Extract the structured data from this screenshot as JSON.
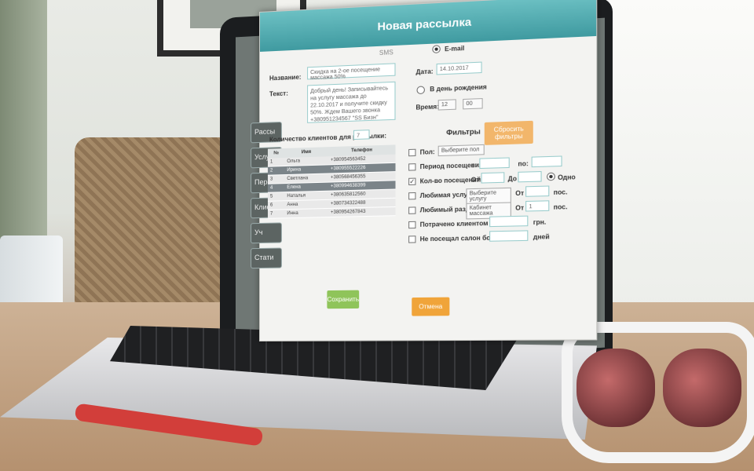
{
  "window": {
    "title": "Новая рассылка"
  },
  "sidebar": {
    "items": [
      "Рассы",
      "Услу",
      "Персо",
      "Клие",
      "Уч",
      "Стати"
    ]
  },
  "form": {
    "sms_label": "SMS",
    "email_label": "E-mail",
    "name_label": "Название:",
    "name_value": "Скидка на 2-ое посещение массажа 50%",
    "text_label": "Текст:",
    "text_value": "Добрый день! Записывайтесь на услугу массажа до 22.10.2017 и получите скидку 50%. Ждем Вашего звонка +380951234567 \"SS Бизн\"",
    "date_label": "Дата:",
    "date_value": "14.10.2017",
    "birthday_label": "В день рождения",
    "time_label": "Время:",
    "hour_value": "12",
    "minute_value": "00",
    "clients_count_label": "Количество клиентов для рассылки:",
    "clients_count_value": "7"
  },
  "table": {
    "headers": [
      "№",
      "Имя",
      "Телефон"
    ],
    "rows": [
      [
        "1",
        "Ольга",
        "+380954563452"
      ],
      [
        "2",
        "Ирина",
        "+380955522226"
      ],
      [
        "3",
        "Светлана",
        "+380568456355"
      ],
      [
        "4",
        "Елена",
        "+380994638399"
      ],
      [
        "5",
        "Наталья",
        "+380635812560"
      ],
      [
        "6",
        "Анна",
        "+380734322488"
      ],
      [
        "7",
        "Инна",
        "+380954267843"
      ]
    ]
  },
  "filters": {
    "title": "Фильтры",
    "reset_label": "Сбросить фильтры",
    "gender_label": "Пол:",
    "gender_value": "Выберите пол",
    "period_label": "Период посещения:",
    "from_short": "с:",
    "to_short": "по:",
    "visits_label": "Кол-во посещений:",
    "from_label": "От",
    "to_label": "До",
    "one_label": "Одно",
    "service_label": "Любимая услуга:",
    "service_value": "Выберите услугу",
    "section_label": "Любимый раздел:",
    "section_value": "Кабинет массажа",
    "section_from": "От",
    "section_count": "1",
    "pos_unit": "пос.",
    "spent_label": "Потрачено клиентом более:",
    "currency": "грн.",
    "absent_label": "Не посещал салон более:",
    "days_unit": "дней"
  },
  "actions": {
    "save": "Сохранить",
    "cancel": "Отмена"
  },
  "colors": {
    "accent": "#4fa9ad",
    "save": "#8fc45a",
    "cancel": "#f0a43a",
    "reset": "#f2b66b"
  }
}
